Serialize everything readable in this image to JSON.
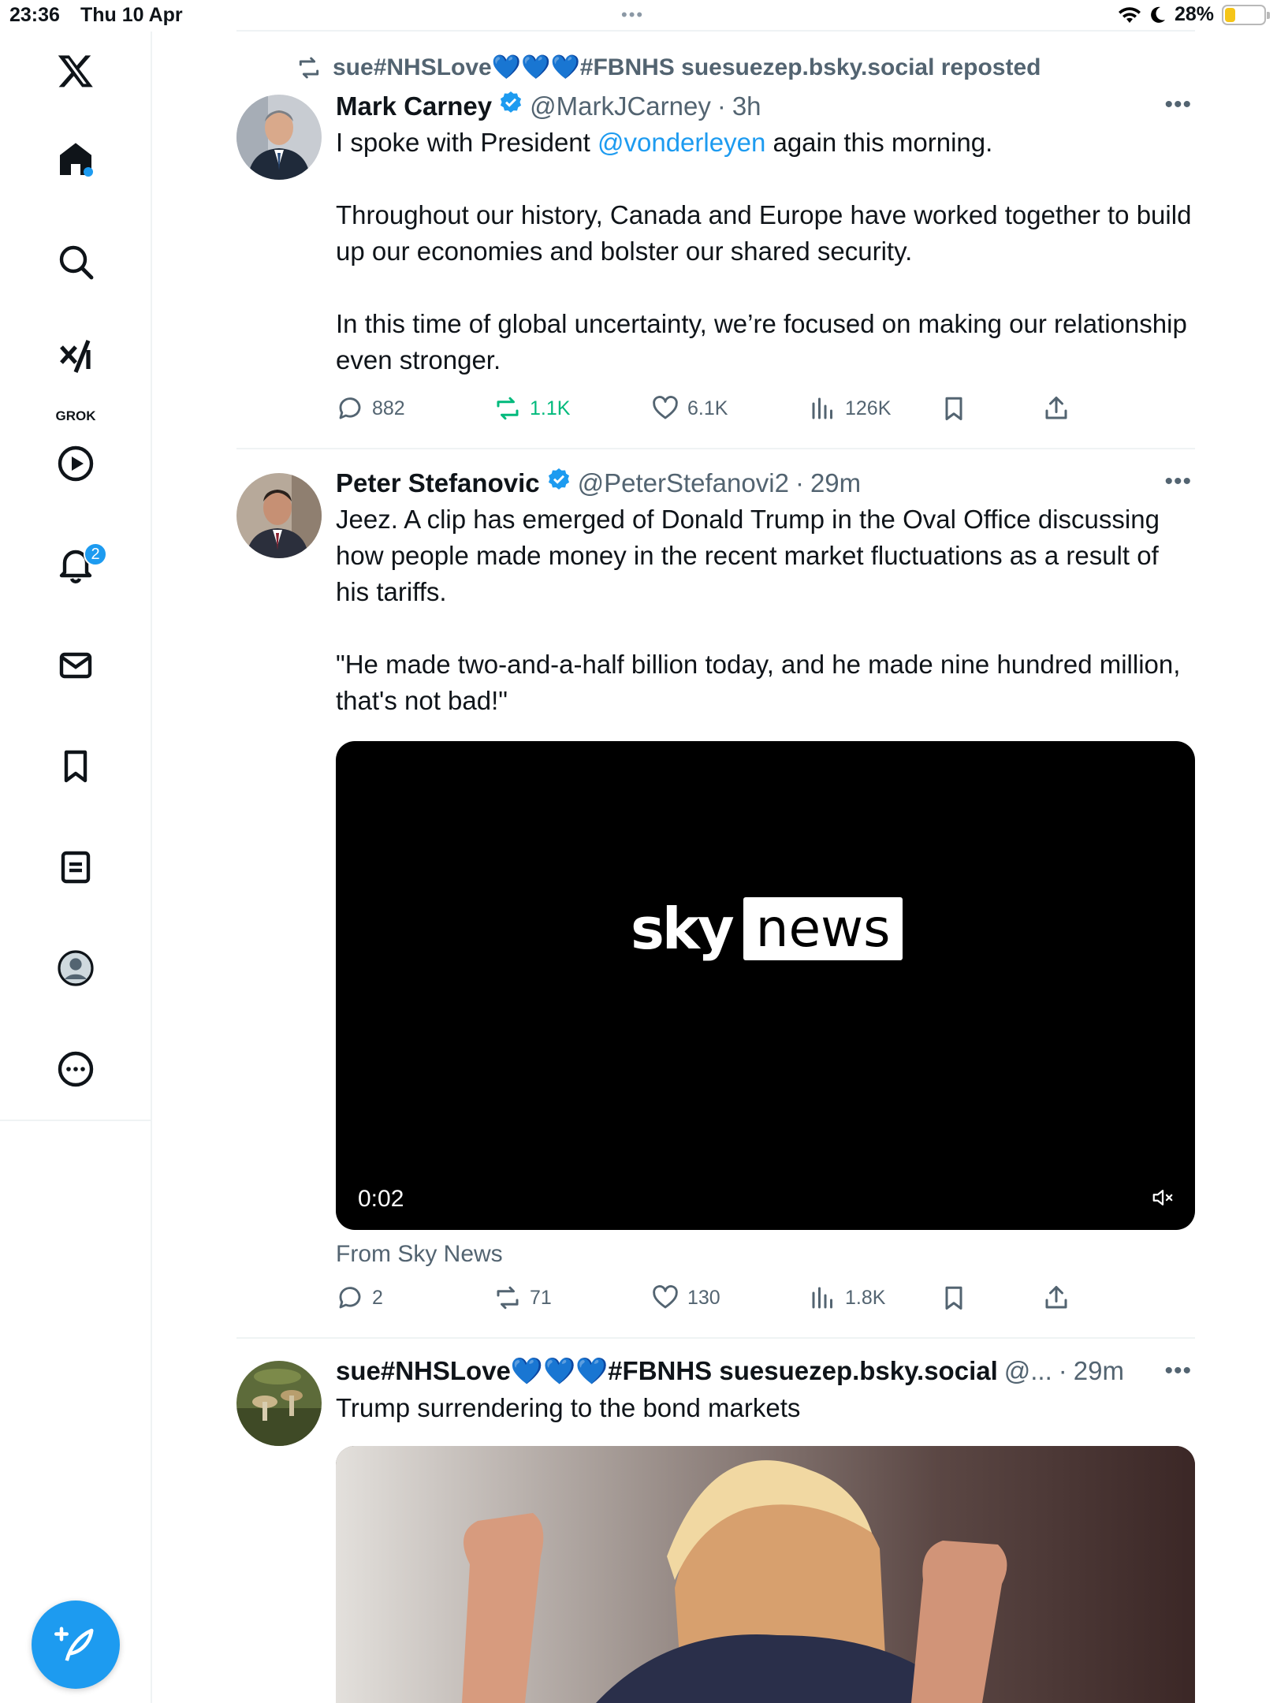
{
  "status_bar": {
    "time": "23:36",
    "date": "Thu 10 Apr",
    "battery_percent": "28%",
    "battery_level": 0.28,
    "multitask_dots": "•••"
  },
  "sidebar": {
    "items": [
      {
        "name": "x-logo",
        "icon": "x-logo-icon"
      },
      {
        "name": "home",
        "icon": "home-icon"
      },
      {
        "name": "explore",
        "icon": "search-icon"
      },
      {
        "name": "grok",
        "icon": "grok-icon",
        "label": "GROK"
      },
      {
        "name": "video",
        "icon": "play-icon"
      },
      {
        "name": "notifications",
        "icon": "bell-icon",
        "badge": "2"
      },
      {
        "name": "messages",
        "icon": "mail-icon"
      },
      {
        "name": "bookmarks",
        "icon": "bookmark-icon"
      },
      {
        "name": "lists",
        "icon": "list-icon"
      },
      {
        "name": "profile",
        "icon": "avatar-icon"
      },
      {
        "name": "more",
        "icon": "more-circle-icon"
      }
    ],
    "compose_icon": "compose-icon"
  },
  "colors": {
    "accent": "#1d9bf0",
    "repost_green": "#00ba7c",
    "secondary_text": "#536471",
    "divider": "#eff3f4"
  },
  "tweets": [
    {
      "repost_by": "sue#NHSLove💙💙💙#FBNHS suesuezep.bsky.social reposted",
      "name": "Mark Carney",
      "verified": true,
      "handle": "@MarkJCarney",
      "sep": "·",
      "time": "3h",
      "text_before_link": "I spoke with President ",
      "link": "@vonderleyen",
      "text_after_link": " again this morning.\n\nThroughout our history, Canada and Europe have worked together to build up our economies and bolster our shared security.\n\nIn this time of global uncertainty, we’re focused on making our relationship even stronger.",
      "replies": "882",
      "reposts": "1.1K",
      "likes": "6.1K",
      "views": "126K"
    },
    {
      "name": "Peter Stefanovic",
      "verified": true,
      "handle": "@PeterStefanovi2",
      "sep": "·",
      "time": "29m",
      "text": "Jeez. A clip has emerged of Donald Trump in the Oval Office discussing how people made money in the recent market fluctuations as a result of his tariffs.\n\n\"He made two-and-a-half billion today, and he made nine hundred million, that's not bad!\"",
      "video": {
        "logo_sky": "sky",
        "logo_news": "news",
        "duration": "0:02",
        "muted_icon": "speaker-muted-icon"
      },
      "from": "From Sky News",
      "replies": "2",
      "reposts": "71",
      "likes": "130",
      "views": "1.8K"
    },
    {
      "name": "sue#NHSLove💙💙💙#FBNHS suesuezep.bsky.social",
      "handle": "@...",
      "sep": "·",
      "time": "29m",
      "text": "Trump surrendering to the bond markets"
    }
  ],
  "more_label": "•••"
}
